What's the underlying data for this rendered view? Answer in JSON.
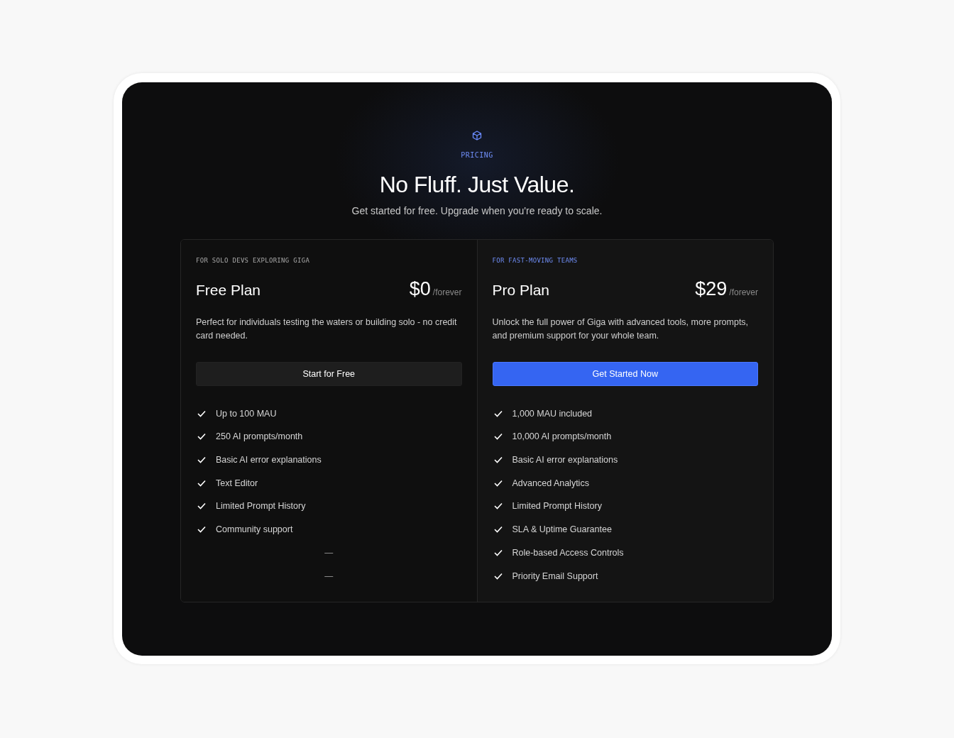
{
  "header": {
    "eyebrow": "PRICING",
    "title": "No Fluff. Just Value.",
    "subtitle": "Get started for free. Upgrade when you're ready to scale."
  },
  "plans": [
    {
      "tagline": "FOR SOLO DEVS EXPLORING GIGA",
      "name": "Free Plan",
      "price": "$0",
      "period": "/forever",
      "description": "Perfect for individuals testing the waters or building solo - no credit card needed.",
      "button": "Start for Free",
      "featured": false,
      "features": [
        {
          "kind": "feature",
          "text": "Up to 100 MAU"
        },
        {
          "kind": "feature",
          "text": "250 AI prompts/month"
        },
        {
          "kind": "feature",
          "text": "Basic AI error explanations"
        },
        {
          "kind": "feature",
          "text": "Text Editor"
        },
        {
          "kind": "feature",
          "text": "Limited Prompt History"
        },
        {
          "kind": "feature",
          "text": "Community support"
        },
        {
          "kind": "empty",
          "text": "—"
        },
        {
          "kind": "empty",
          "text": "—"
        }
      ]
    },
    {
      "tagline": "FOR FAST-MOVING TEAMS",
      "name": "Pro Plan",
      "price": "$29",
      "period": "/forever",
      "description": "Unlock the full power of Giga with advanced tools, more prompts, and premium support for your whole team.",
      "button": "Get Started Now",
      "featured": true,
      "features": [
        {
          "kind": "feature",
          "text": "1,000 MAU included"
        },
        {
          "kind": "feature",
          "text": "10,000 AI prompts/month"
        },
        {
          "kind": "feature",
          "text": "Basic AI error explanations"
        },
        {
          "kind": "feature",
          "text": "Advanced Analytics"
        },
        {
          "kind": "feature",
          "text": "Limited Prompt History"
        },
        {
          "kind": "feature",
          "text": "SLA & Uptime Guarantee"
        },
        {
          "kind": "feature",
          "text": "Role-based Access Controls"
        },
        {
          "kind": "feature",
          "text": "Priority Email Support"
        }
      ]
    }
  ]
}
